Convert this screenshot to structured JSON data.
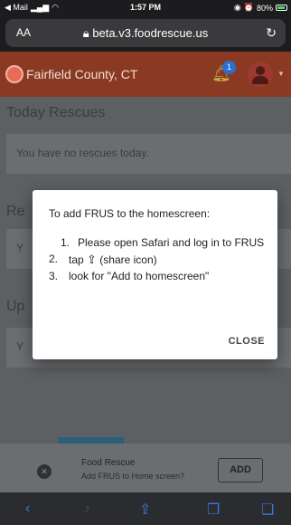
{
  "status_bar": {
    "back_app": "◀ Mail",
    "time": "1:57 PM",
    "battery": "80%"
  },
  "browser": {
    "text_size": "AA",
    "url": "beta.v3.foodrescue.us",
    "reload_icon": "reload-icon"
  },
  "header": {
    "region": "Fairfield County, CT",
    "notification_count": "1"
  },
  "page": {
    "today_title": "Today Rescues",
    "today_empty": "You have no rescues today.",
    "section2_prefix": "Re",
    "section2_card_prefix": "Y",
    "section3_prefix": "Up",
    "section3_card_prefix": "Y"
  },
  "dialog": {
    "title": "To add FRUS to the homescreen:",
    "steps": [
      {
        "num": "1.",
        "text": "Please open Safari and log in to FRUS"
      },
      {
        "num": "2.",
        "text_before": "tap",
        "text_after": "(share icon)"
      },
      {
        "num": "3.",
        "text": "look for \"Add to homescreen\""
      }
    ],
    "close_label": "CLOSE"
  },
  "banner": {
    "title": "Food Rescue",
    "subtitle": "Add FRUS to Home screen?",
    "add_label": "ADD"
  },
  "colors": {
    "header_bg": "#8a3a22",
    "accent_blue": "#3a78d8"
  }
}
